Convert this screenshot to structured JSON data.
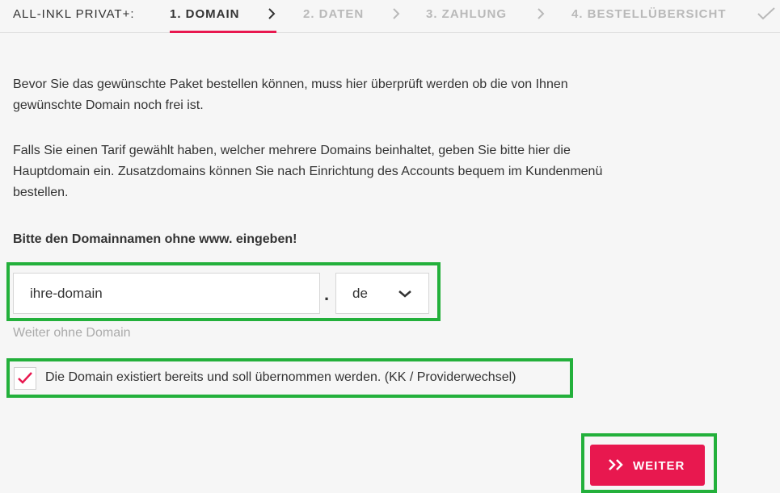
{
  "steps": {
    "brand": "ALL-INKL PRIVAT+:",
    "step1": "1. DOMAIN",
    "step2": "2. DATEN",
    "step3": "3. ZAHLUNG",
    "step4": "4. BESTELLÜBERSICHT"
  },
  "content": {
    "para1_line1": "Bevor Sie das gewünschte Paket bestellen können, muss hier überprüft werden ob die von Ihnen",
    "para1_line2": "gewünschte Domain noch frei ist.",
    "para2_line1": "Falls Sie einen Tarif gewählt haben, welcher mehrere Domains beinhaltet, geben Sie bitte hier die",
    "para2_line2": "Hauptdomain ein. Zusatzdomains können Sie nach Einrichtung des Accounts bequem im Kundenmenü",
    "para2_line3": "bestellen.",
    "label": "Bitte den Domainnamen ohne www. eingeben!"
  },
  "form": {
    "domain_value": "ihre-domain",
    "separator": ".",
    "tld_value": "de",
    "skip_link": "Weiter ohne Domain",
    "checkbox_checked": true,
    "checkbox_label": "Die Domain existiert bereits und soll übernommen werden. (KK / Providerwechsel)",
    "submit_label": "WEITER"
  },
  "colors": {
    "accent": "#e8184f",
    "highlight": "#23b03b",
    "inactive": "#b9b9b9",
    "background": "#f6f6f6"
  },
  "icons": {
    "step_separator": "chevron-right-icon",
    "completion": "checkmark-icon",
    "select": "chevron-down-icon",
    "checkbox": "checkmark-icon",
    "submit": "double-chevron-right-icon"
  }
}
